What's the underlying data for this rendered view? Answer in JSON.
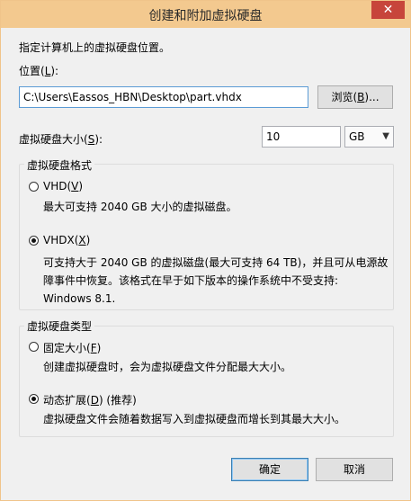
{
  "window": {
    "title": "创建和附加虚拟硬盘",
    "close_glyph": "✕"
  },
  "instruction": "指定计算机上的虚拟硬盘位置。",
  "location": {
    "label": "位置(",
    "label_key": "L",
    "label_end": "):",
    "value": "C:\\Users\\Eassos_HBN\\Desktop\\part.vhdx",
    "browse_label": "浏览(",
    "browse_key": "B",
    "browse_end": ")..."
  },
  "size": {
    "label": "虚拟硬盘大小(",
    "label_key": "S",
    "label_end": "):",
    "value": "10",
    "unit_selected": "GB"
  },
  "format_group": {
    "title": "虚拟硬盘格式",
    "options": [
      {
        "label": "VHD(",
        "key": "V",
        "label_end": ")",
        "checked": false,
        "description": "最大可支持 2040 GB 大小的虚拟磁盘。"
      },
      {
        "label": "VHDX(",
        "key": "X",
        "label_end": ")",
        "checked": true,
        "description_lines": [
          "可支持大于 2040 GB 的虚拟磁盘(最大可支持 64 TB)，并且可从电源故",
          "障事件中恢复。该格式在早于如下版本的操作系统中不受支持:",
          "Windows 8.1."
        ]
      }
    ]
  },
  "type_group": {
    "title": "虚拟硬盘类型",
    "options": [
      {
        "label": "固定大小(",
        "key": "F",
        "label_end": ")",
        "checked": false,
        "description": "创建虚拟硬盘时，会为虚拟硬盘文件分配最大大小。"
      },
      {
        "label": "动态扩展(",
        "key": "D",
        "label_end": ") (推荐)",
        "checked": true,
        "description": "虚拟硬盘文件会随着数据写入到虚拟硬盘而增长到其最大大小。"
      }
    ]
  },
  "buttons": {
    "ok": "确定",
    "cancel": "取消"
  },
  "icons": {
    "close": "close-icon",
    "dropdown": "chevron-down-icon"
  }
}
